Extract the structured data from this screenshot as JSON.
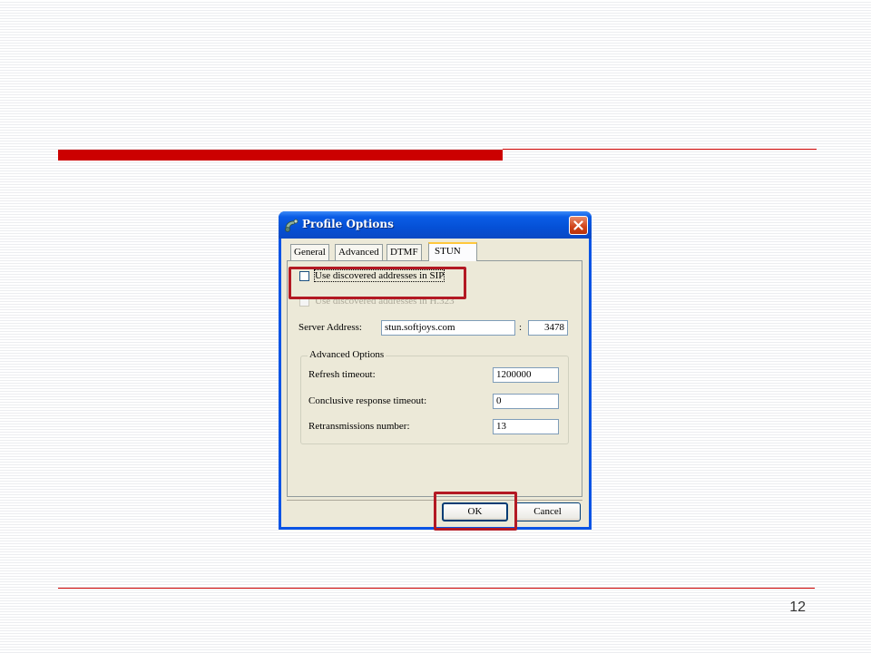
{
  "page_number": "12",
  "dialog": {
    "title": "Profile Options",
    "tabs": [
      {
        "label": "General"
      },
      {
        "label": "Advanced"
      },
      {
        "label": "DTMF"
      },
      {
        "label": "STUN"
      }
    ],
    "active_tab": "STUN",
    "use_sip": {
      "label": "Use discovered addresses in SIP",
      "checked": false
    },
    "use_h323": {
      "label": "Use discovered addresses in H.323",
      "checked": false,
      "disabled": true
    },
    "server_address": {
      "label": "Server Address:",
      "value": "stun.softjoys.com",
      "separator": ":",
      "port": "3478"
    },
    "advanced_options": {
      "title": "Advanced Options",
      "refresh_timeout": {
        "label": "Refresh timeout:",
        "value": "1200000"
      },
      "conclusive_timeout": {
        "label": "Conclusive response timeout:",
        "value": "0"
      },
      "retransmissions": {
        "label": "Retransmissions number:",
        "value": "13"
      }
    },
    "ok_label": "OK",
    "cancel_label": "Cancel"
  },
  "colors": {
    "accent": "#cc0000",
    "highlight": "#b31923",
    "titlebar": "#0a54e5"
  }
}
